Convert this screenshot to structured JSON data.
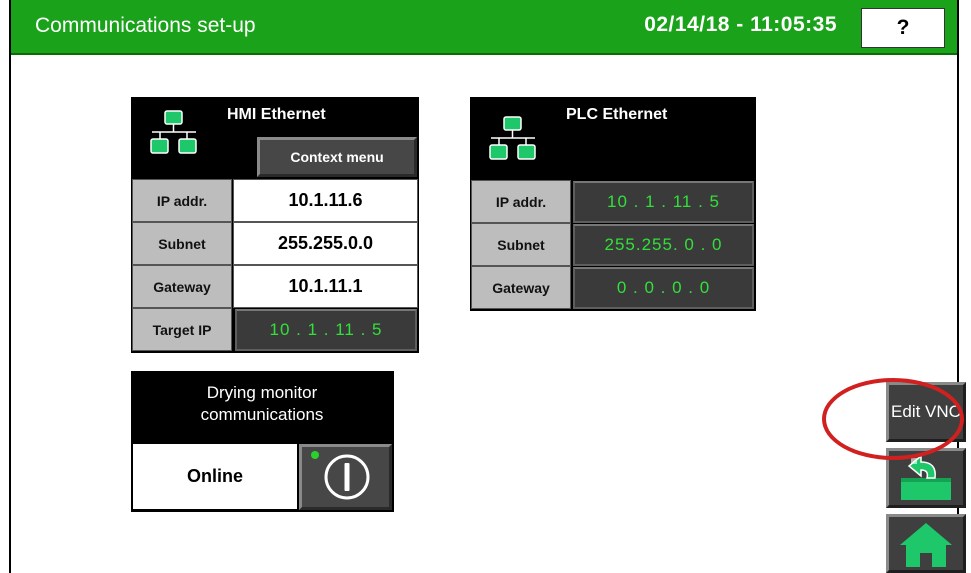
{
  "header": {
    "title": "Communications set-up",
    "datetime": "02/14/18 - 11:05:35",
    "help_label": "?"
  },
  "hmi_ethernet": {
    "title": "HMI Ethernet",
    "context_menu_label": "Context menu",
    "rows": [
      {
        "label": "IP addr.",
        "value": "10.1.11.6"
      },
      {
        "label": "Subnet",
        "value": "255.255.0.0"
      },
      {
        "label": "Gateway",
        "value": "10.1.11.1"
      },
      {
        "label": "Target IP",
        "value": "10 . 1 . 11 . 5"
      }
    ]
  },
  "plc_ethernet": {
    "title": "PLC Ethernet",
    "rows": [
      {
        "label": "IP addr.",
        "value": "10 . 1 . 11 . 5"
      },
      {
        "label": "Subnet",
        "value": "255.255. 0 . 0"
      },
      {
        "label": "Gateway",
        "value": "0 . 0 . 0 . 0"
      }
    ]
  },
  "drying_monitor": {
    "title": "Drying monitor communications",
    "status": "Online"
  },
  "side": {
    "edit_vnc_label": "Edit VNC"
  },
  "colors": {
    "header_green": "#1aa31a",
    "value_green": "#32e03a",
    "icon_green": "#1ec86a",
    "highlight_red": "#d02020"
  }
}
